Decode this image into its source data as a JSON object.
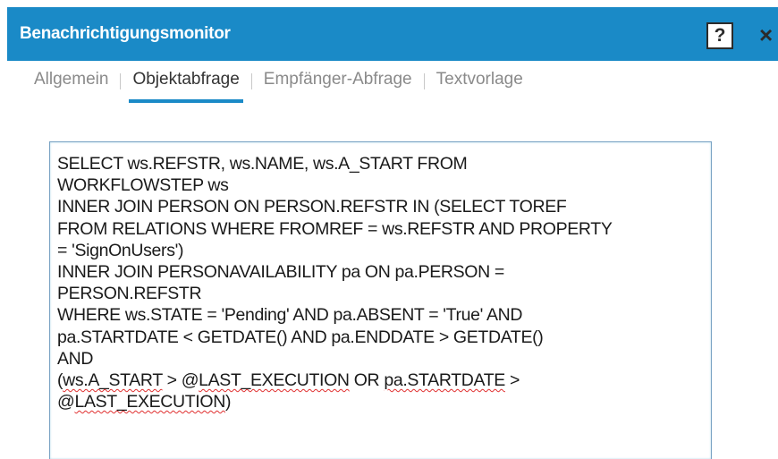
{
  "dialog": {
    "title": "Benachrichtigungsmonitor",
    "help_label": "?",
    "close_label": "×"
  },
  "tabs": [
    {
      "label": "Allgemein",
      "active": false
    },
    {
      "label": "Objektabfrage",
      "active": true
    },
    {
      "label": "Empfänger-Abfrage",
      "active": false
    },
    {
      "label": "Textvorlage",
      "active": false
    }
  ],
  "query": {
    "lines": [
      "SELECT ws.REFSTR, ws.NAME, ws.A_START FROM",
      "WORKFLOWSTEP ws",
      "INNER JOIN PERSON ON PERSON.REFSTR IN (SELECT TOREF",
      "FROM RELATIONS WHERE FROMREF = ws.REFSTR AND PROPERTY",
      "= 'SignOnUsers')",
      "INNER JOIN PERSONAVAILABILITY pa ON pa.PERSON =",
      "PERSON.REFSTR",
      "WHERE ws.STATE = 'Pending' AND pa.ABSENT = 'True' AND",
      "pa.STARTDATE < GETDATE() AND pa.ENDDATE > GETDATE()",
      "AND"
    ],
    "line11": {
      "p1": "(",
      "w1": "ws.A_START",
      "p2": " > @",
      "w2": "LAST_EXECUTION",
      "p3": " OR ",
      "w3": "pa.STARTDATE",
      "p4": " >"
    },
    "line12": {
      "p1": "@",
      "w1": "LAST_EXECUTION",
      "p2": ")"
    }
  },
  "colors": {
    "titlebar": "#1a8ac7",
    "active_tab_underline": "#1a8ac7",
    "spellcheck_underline": "#e03030"
  }
}
